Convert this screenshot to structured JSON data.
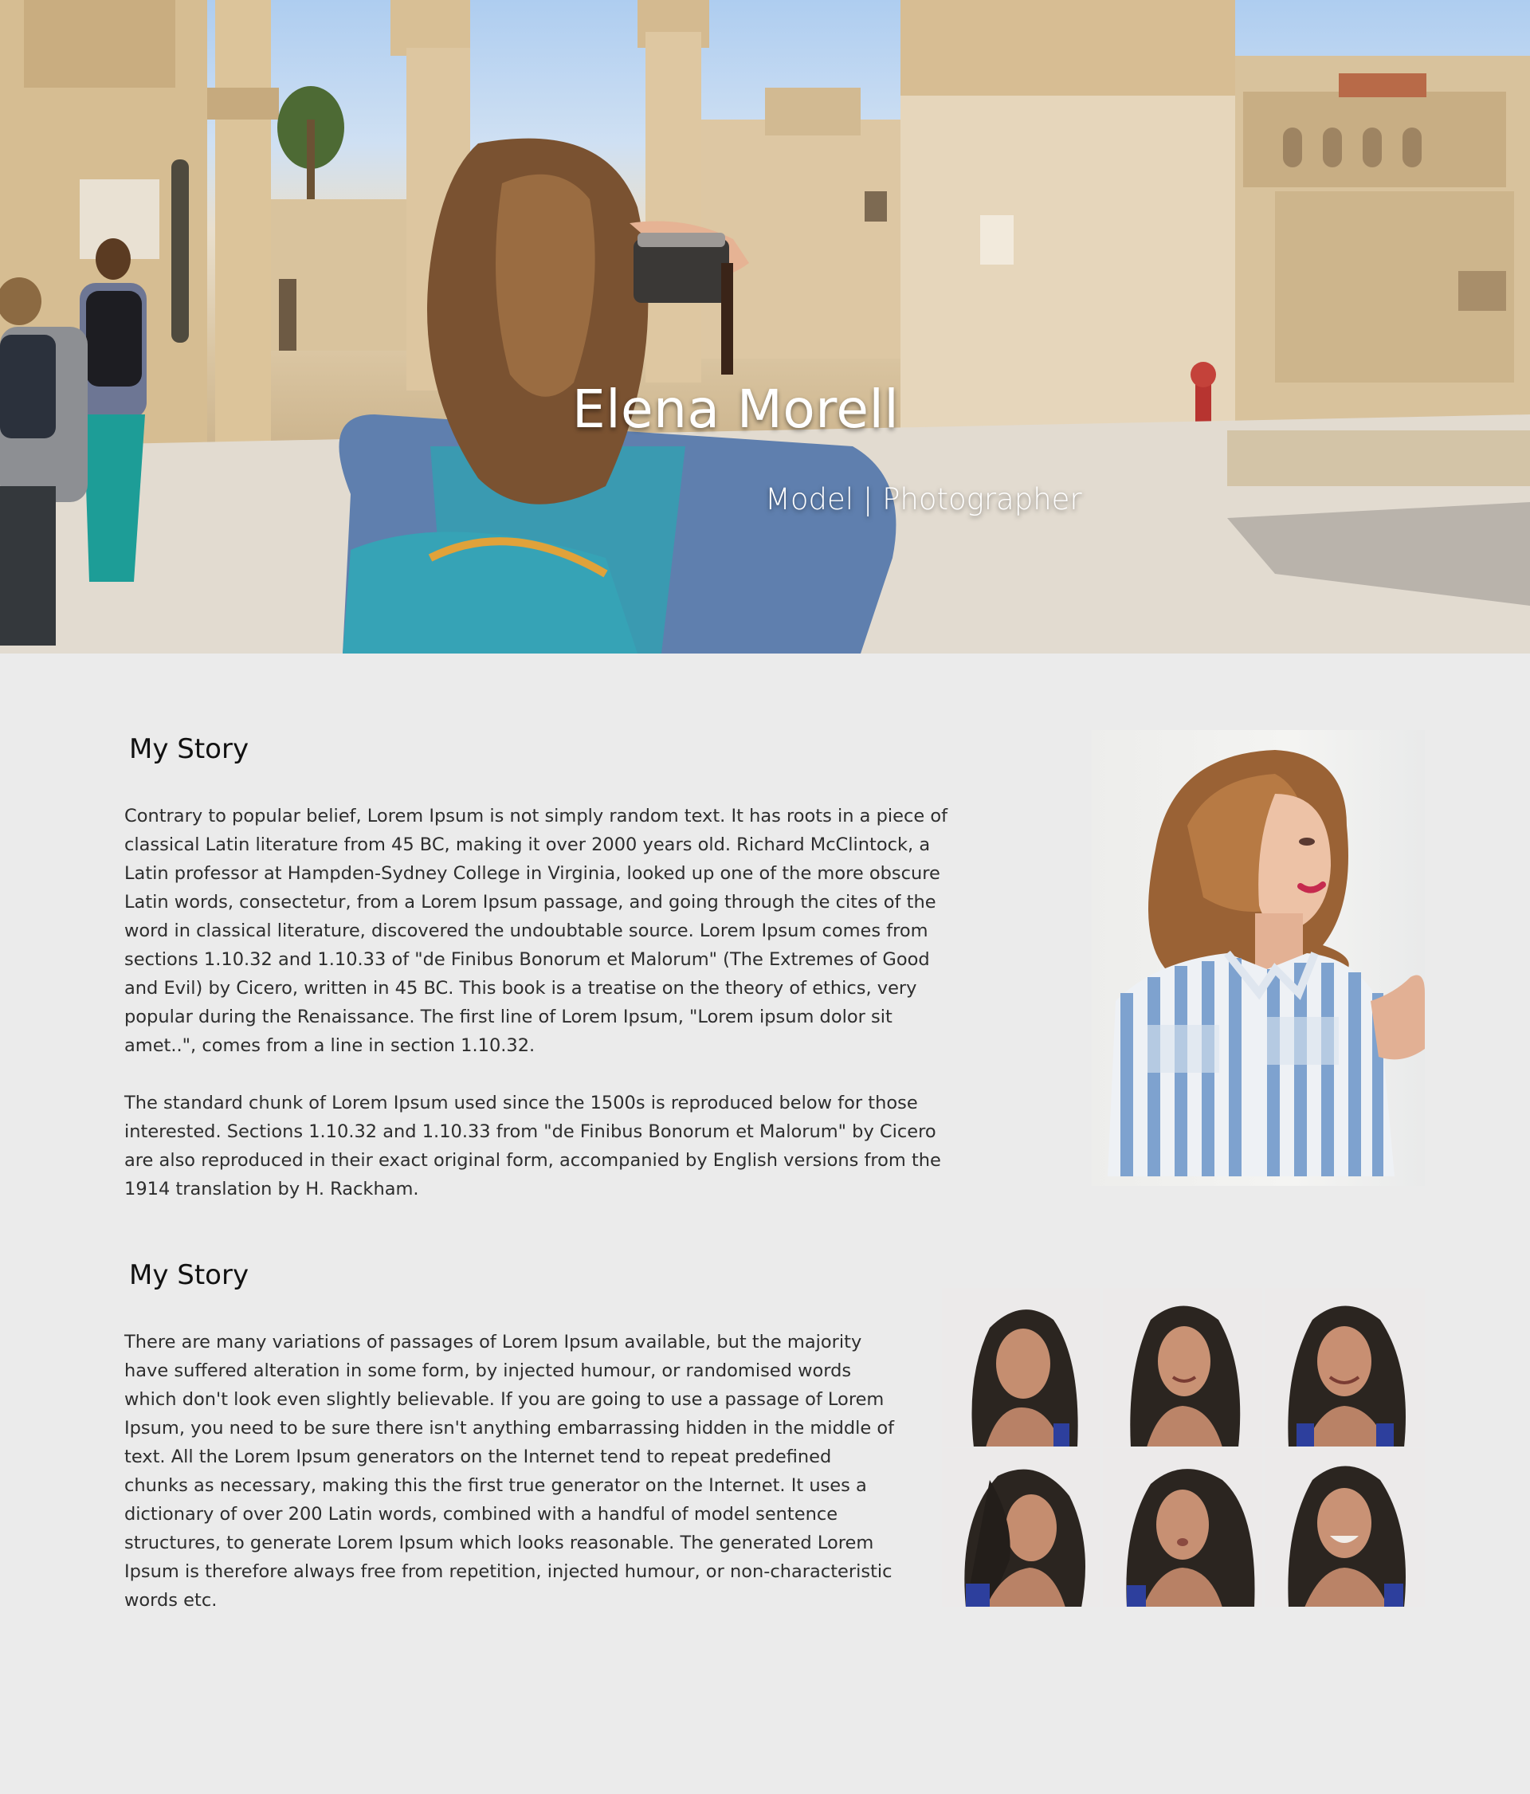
{
  "hero": {
    "name": "Elena Morell",
    "tagline": "Model | Photographer"
  },
  "story_section_1": {
    "heading": "My Story",
    "paragraphs": [
      "Contrary to popular belief, Lorem Ipsum is not simply random text. It has roots in a piece of classical Latin literature from 45 BC, making it over 2000 years old. Richard McClintock, a Latin professor at Hampden-Sydney College in Virginia, looked up one of the more obscure Latin words, consectetur, from a Lorem Ipsum passage, and going through the cites of the word in classical literature, discovered the undoubtable source. Lorem Ipsum comes from sections 1.10.32 and 1.10.33 of \"de Finibus Bonorum et Malorum\" (The Extremes of Good and Evil) by Cicero, written in 45 BC. This book is a treatise on the theory of ethics, very popular during the Renaissance. The first line of Lorem Ipsum, \"Lorem ipsum dolor sit amet..\", comes from a line in section 1.10.32.",
      "The standard chunk of Lorem Ipsum used since the 1500s is reproduced below for those interested. Sections 1.10.32 and 1.10.33 from \"de Finibus Bonorum et Malorum\" by Cicero are also reproduced in their exact original form, accompanied by English versions from the 1914 translation by H. Rackham."
    ]
  },
  "story_section_2": {
    "heading": "My Story",
    "paragraphs": [
      "There are many variations of passages of Lorem Ipsum available, but the majority have suffered alteration in some form, by injected humour, or randomised words which don't look even slightly believable. If you are going to use a passage of Lorem Ipsum, you need to be sure there isn't anything embarrassing hidden in the middle of text. All the Lorem Ipsum generators on the Internet tend to repeat predefined chunks as necessary, making this the first true generator on the Internet. It uses a dictionary of over 200 Latin words, combined with a handful of model sentence structures, to generate Lorem Ipsum which looks reasonable. The generated Lorem Ipsum is therefore always free from repetition, injected humour, or non-characteristic words etc."
    ]
  },
  "colors": {
    "page_background": "#ebebeb",
    "heading_text": "#111111",
    "body_text": "#2d2d2d",
    "hero_text": "#ffffff"
  }
}
